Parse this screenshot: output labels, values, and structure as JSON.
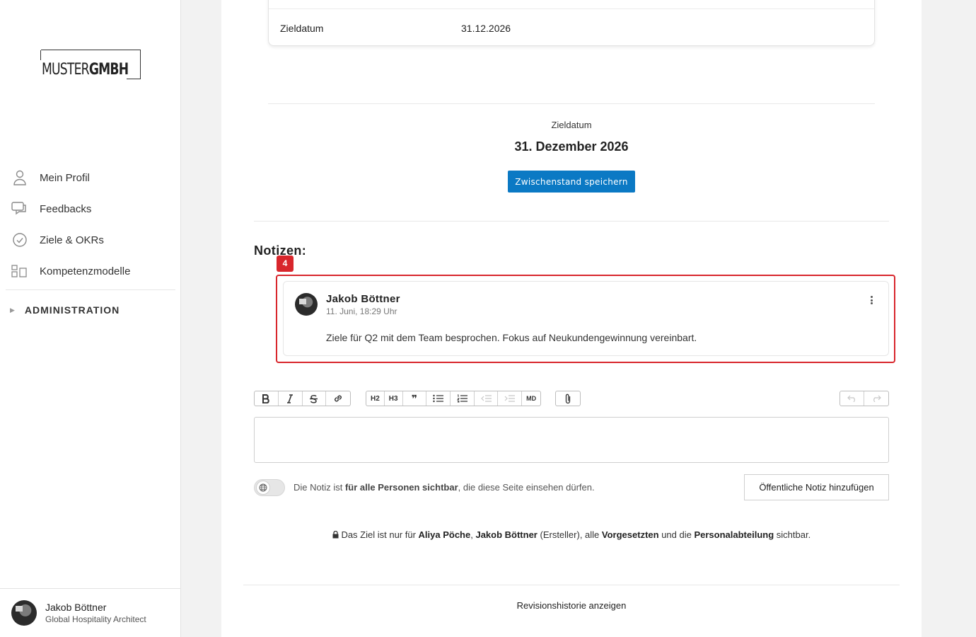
{
  "brand": {
    "logo_light": "MUSTER",
    "logo_bold": "GMBH"
  },
  "sidebar": {
    "items": [
      {
        "label": "Mein Profil",
        "icon": "user-icon"
      },
      {
        "label": "Feedbacks",
        "icon": "chat-bubbles-icon"
      },
      {
        "label": "Ziele & OKRs",
        "icon": "check-circle-icon"
      },
      {
        "label": "Kompetenzmodelle",
        "icon": "grid-blocks-icon"
      }
    ],
    "admin_label": "ADMINISTRATION",
    "user": {
      "name": "Jakob Böttner",
      "role": "Global Hospitality Architect"
    }
  },
  "goal": {
    "table_key": "Zieldatum",
    "table_value": "31.12.2026",
    "target_label": "Zieldatum",
    "target_value": "31. Dezember 2026",
    "save_label": "Zwischenstand speichern"
  },
  "notes": {
    "title": "Notizen:",
    "badge": "4",
    "items": [
      {
        "author": "Jakob Böttner",
        "time": "11. Juni, 18:29 Uhr",
        "text": "Ziele für Q2 mit dem Team besprochen. Fokus auf Neukundengewinnung vereinbart."
      }
    ]
  },
  "toolbar": {
    "h2": "H2",
    "h3": "H3",
    "quote": "❞",
    "md": "MD"
  },
  "visibility": {
    "prefix": "Die Notiz ist ",
    "bold": "für alle Personen sichtbar",
    "suffix": ", die diese Seite einsehen dürfen.",
    "add_label": "Öffentliche Notiz hinzufügen"
  },
  "privacy": {
    "p1": "Das Ziel ist nur für ",
    "b1": "Aliya Pöche",
    "p2": ", ",
    "b2": "Jakob Böttner",
    "p3": " (Ersteller), alle ",
    "b3": "Vorgesetzten",
    "p4": " und die ",
    "b4": "Personalabteilung",
    "p5": " sichtbar."
  },
  "revision_link": "Revisionshistorie anzeigen",
  "colors": {
    "primary": "#0b79c4",
    "highlight": "#d8262c"
  }
}
